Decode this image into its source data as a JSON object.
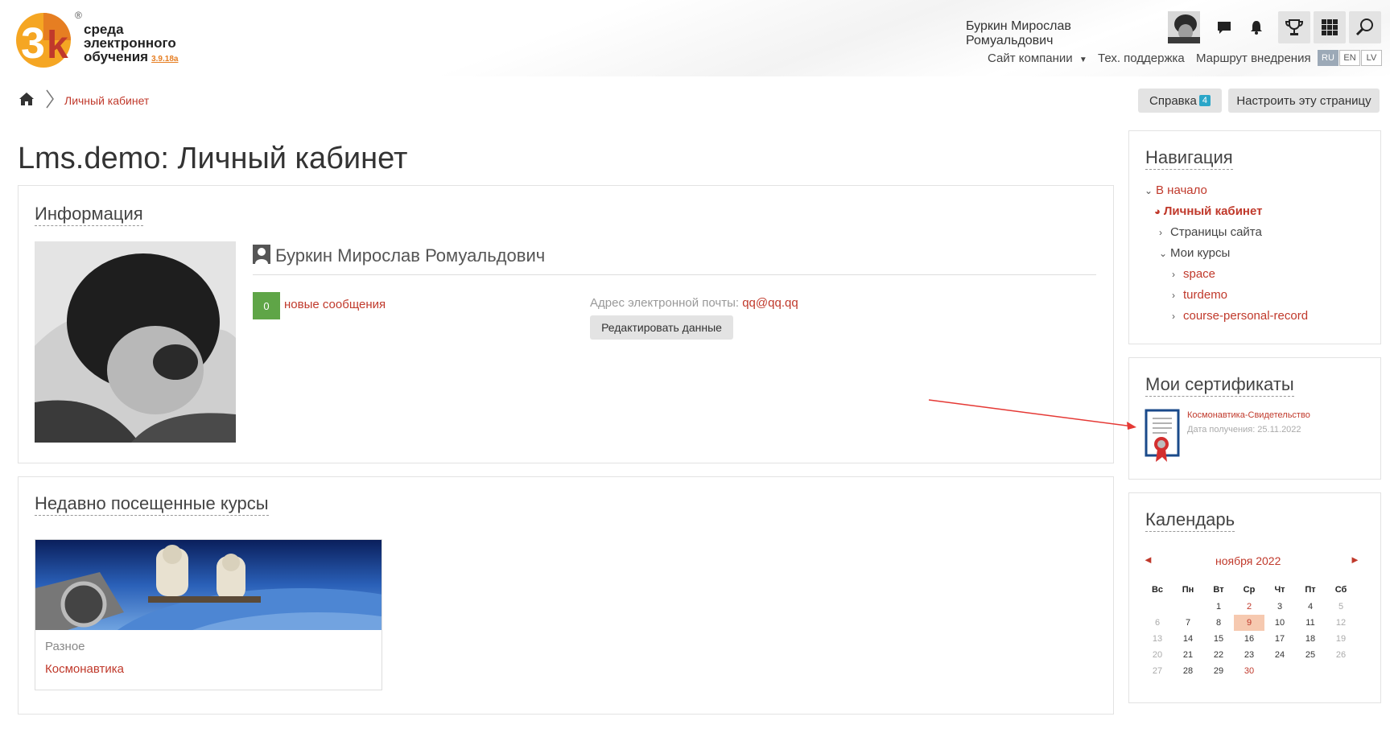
{
  "header": {
    "logo": {
      "line1": "среда",
      "line2": "электронного",
      "line3": "обучения",
      "version": "3.9.18a",
      "registered": "®",
      "mark": "3k"
    },
    "user_name": "Буркин Мирослав Ромуальдович",
    "icons": [
      "chat-icon",
      "bell-icon",
      "trophy-icon",
      "grid-icon",
      "search-icon"
    ],
    "nav": {
      "company_site": "Сайт компании",
      "support": "Тех. поддержка",
      "route": "Маршрут внедрения"
    },
    "languages": [
      "RU",
      "EN",
      "LV"
    ]
  },
  "breadcrumb": {
    "current": "Личный кабинет"
  },
  "actions": {
    "help_label": "Справка",
    "help_count": "4",
    "customize_label": "Настроить эту страницу"
  },
  "page_title": "Lms.demo: Личный кабинет",
  "info": {
    "title": "Информация",
    "name": "Буркин Мирослав Ромуальдович",
    "messages_count": "0",
    "messages_label": "новые сообщения",
    "email_label": "Адрес электронной почты:",
    "email_value": "qq@qq.qq",
    "edit_button": "Редактировать данные"
  },
  "recent": {
    "title": "Недавно посещенные курсы",
    "course_category": "Разное",
    "course_name": "Космонавтика"
  },
  "navigation": {
    "title": "Навигация",
    "home": "В начало",
    "dashboard": "Личный кабинет",
    "site_pages": "Страницы сайта",
    "my_courses": "Мои курсы",
    "courses": [
      "space",
      "turdemo",
      "course-personal-record"
    ]
  },
  "certificates": {
    "title": "Мои сертификаты",
    "name": "Космонавтика-Свидетельство",
    "date": "Дата получения: 25.11.2022"
  },
  "calendar": {
    "title": "Календарь",
    "month": "ноября 2022",
    "prev": "◄",
    "next": "►",
    "days": [
      "Вс",
      "Пн",
      "Вт",
      "Ср",
      "Чт",
      "Пт",
      "Сб"
    ],
    "weeks": [
      [
        "",
        "",
        "1",
        "2",
        "3",
        "4",
        "5"
      ],
      [
        "6",
        "7",
        "8",
        "9",
        "10",
        "11",
        "12"
      ],
      [
        "13",
        "14",
        "15",
        "16",
        "17",
        "18",
        "19"
      ],
      [
        "20",
        "21",
        "22",
        "23",
        "24",
        "25",
        "26"
      ],
      [
        "27",
        "28",
        "29",
        "30",
        "",
        "",
        ""
      ]
    ],
    "today": "9",
    "event_day": "2",
    "highlight_day": "30"
  },
  "colors": {
    "accent": "#c0392b",
    "message_badge": "#5fa547",
    "help_badge": "#2aa6c8",
    "today_bg": "#f6c9b0",
    "active_lang": "#9ca9b7"
  }
}
